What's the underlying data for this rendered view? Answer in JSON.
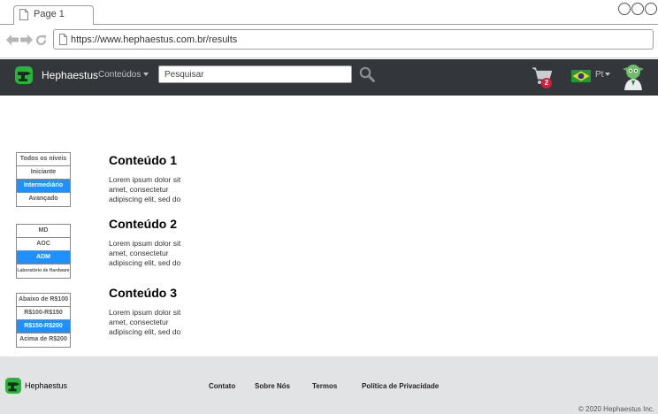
{
  "browser": {
    "tab_title": "Page 1",
    "url": "https://www.hephaestus.com.br/results"
  },
  "header": {
    "brand": "Hephaestus",
    "menu_label": "Conteúdos",
    "search_placeholder": "Pesquisar",
    "cart_count": "2",
    "language": "Pt"
  },
  "filters": {
    "levels": [
      "Todos os níveis",
      "Iniciante",
      "Intermediário",
      "Avançado"
    ],
    "levels_active": "Intermediário",
    "areas": [
      "MD",
      "AOC",
      "ADM",
      "Laboratório de Hardware"
    ],
    "areas_active": "ADM",
    "prices": [
      "Abaixo de R$100",
      "R$100-R$150",
      "R$150-R$200",
      "Acima de R$200"
    ],
    "prices_active": "R$150-R$200"
  },
  "results": [
    {
      "title": "Conteúdo 1",
      "text": "Lorem ipsum dolor sit amet, consectetur adipiscing elit, sed do"
    },
    {
      "title": "Conteúdo 2",
      "text": "Lorem ipsum dolor sit amet, consectetur adipiscing elit, sed do"
    },
    {
      "title": "Conteúdo 3",
      "text": "Lorem ipsum dolor sit amet, consectetur adipiscing elit, sed do"
    }
  ],
  "footer": {
    "brand": "Hephaestus",
    "links": [
      "Contato",
      "Sobre Nós",
      "Termos",
      "Política de Privacidade"
    ],
    "copyright": "© 2020 Hephaestus Inc."
  },
  "colors": {
    "header_bg": "#33373c",
    "accent": "#1e90ff",
    "badge": "#d0203a",
    "footer_bg": "#e2e3e5"
  },
  "icons": [
    "page-icon",
    "back-arrow-icon",
    "forward-arrow-icon",
    "reload-icon",
    "caret-down-icon",
    "search-icon",
    "cart-icon",
    "brazil-flag-icon",
    "avatar-icon",
    "logo-icon"
  ]
}
